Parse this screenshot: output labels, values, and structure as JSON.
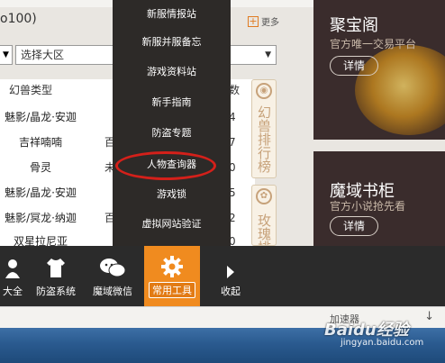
{
  "page": {
    "title_fragment": "o100)",
    "more_label": "更多"
  },
  "filters": {
    "left_arrow": "▼",
    "region_label": "选择大区",
    "region_arrow": "▼"
  },
  "table": {
    "header": "幻兽类型",
    "header_right": "数",
    "rows": [
      {
        "name": "魅影/晶龙·安迦",
        "c2": "",
        "c3": "4"
      },
      {
        "name": "吉祥喃喃",
        "c2": "百",
        "c3": "7"
      },
      {
        "name": "骨灵",
        "c2": "未",
        "c3": "0"
      },
      {
        "name": "魅影/晶龙·安迦",
        "c2": "",
        "c3": "5"
      },
      {
        "name": "魅影/冥龙·纳迦",
        "c2": "百",
        "c3": "2"
      },
      {
        "name": "双星拉尼亚",
        "c2": "",
        "c3": "0"
      }
    ]
  },
  "side_tabs": {
    "pet_rank": "幻兽排行榜",
    "rose_rank": "玫瑰排"
  },
  "promos": [
    {
      "title": "聚宝阁",
      "subtitle": "官方唯一交易平台",
      "button": "详情"
    },
    {
      "title": "魔域书柜",
      "subtitle": "官方小说抢先看",
      "button": "详情"
    }
  ],
  "menu": {
    "items": [
      "新服情报站",
      "新服并服备忘",
      "游戏资料站",
      "新手指南",
      "防盗专题",
      "人物查询器",
      "游戏锁",
      "虚拟网站验证"
    ],
    "highlighted_index": 5
  },
  "toolbar": {
    "items": [
      {
        "label": "大全",
        "icon": "user-icon"
      },
      {
        "label": "防盗系统",
        "icon": "shirt-icon"
      },
      {
        "label": "魔域微信",
        "icon": "wechat-icon"
      },
      {
        "label": "常用工具",
        "icon": "gear-icon"
      },
      {
        "label": "收起",
        "icon": "arrow-right-icon"
      }
    ],
    "active": "常用工具"
  },
  "statusbar": {
    "speed_label": "加速器",
    "download_icon": "↓"
  },
  "watermark": {
    "brand": "Baidu经验",
    "url": "jingyan.baidu.com"
  },
  "colors": {
    "accent": "#f08b1f",
    "menu_bg": "#2d2a28",
    "highlight_ring": "#d4201a",
    "promo_bg": "#3a2c2c",
    "toolbar_bg": "#2b2b2b"
  }
}
